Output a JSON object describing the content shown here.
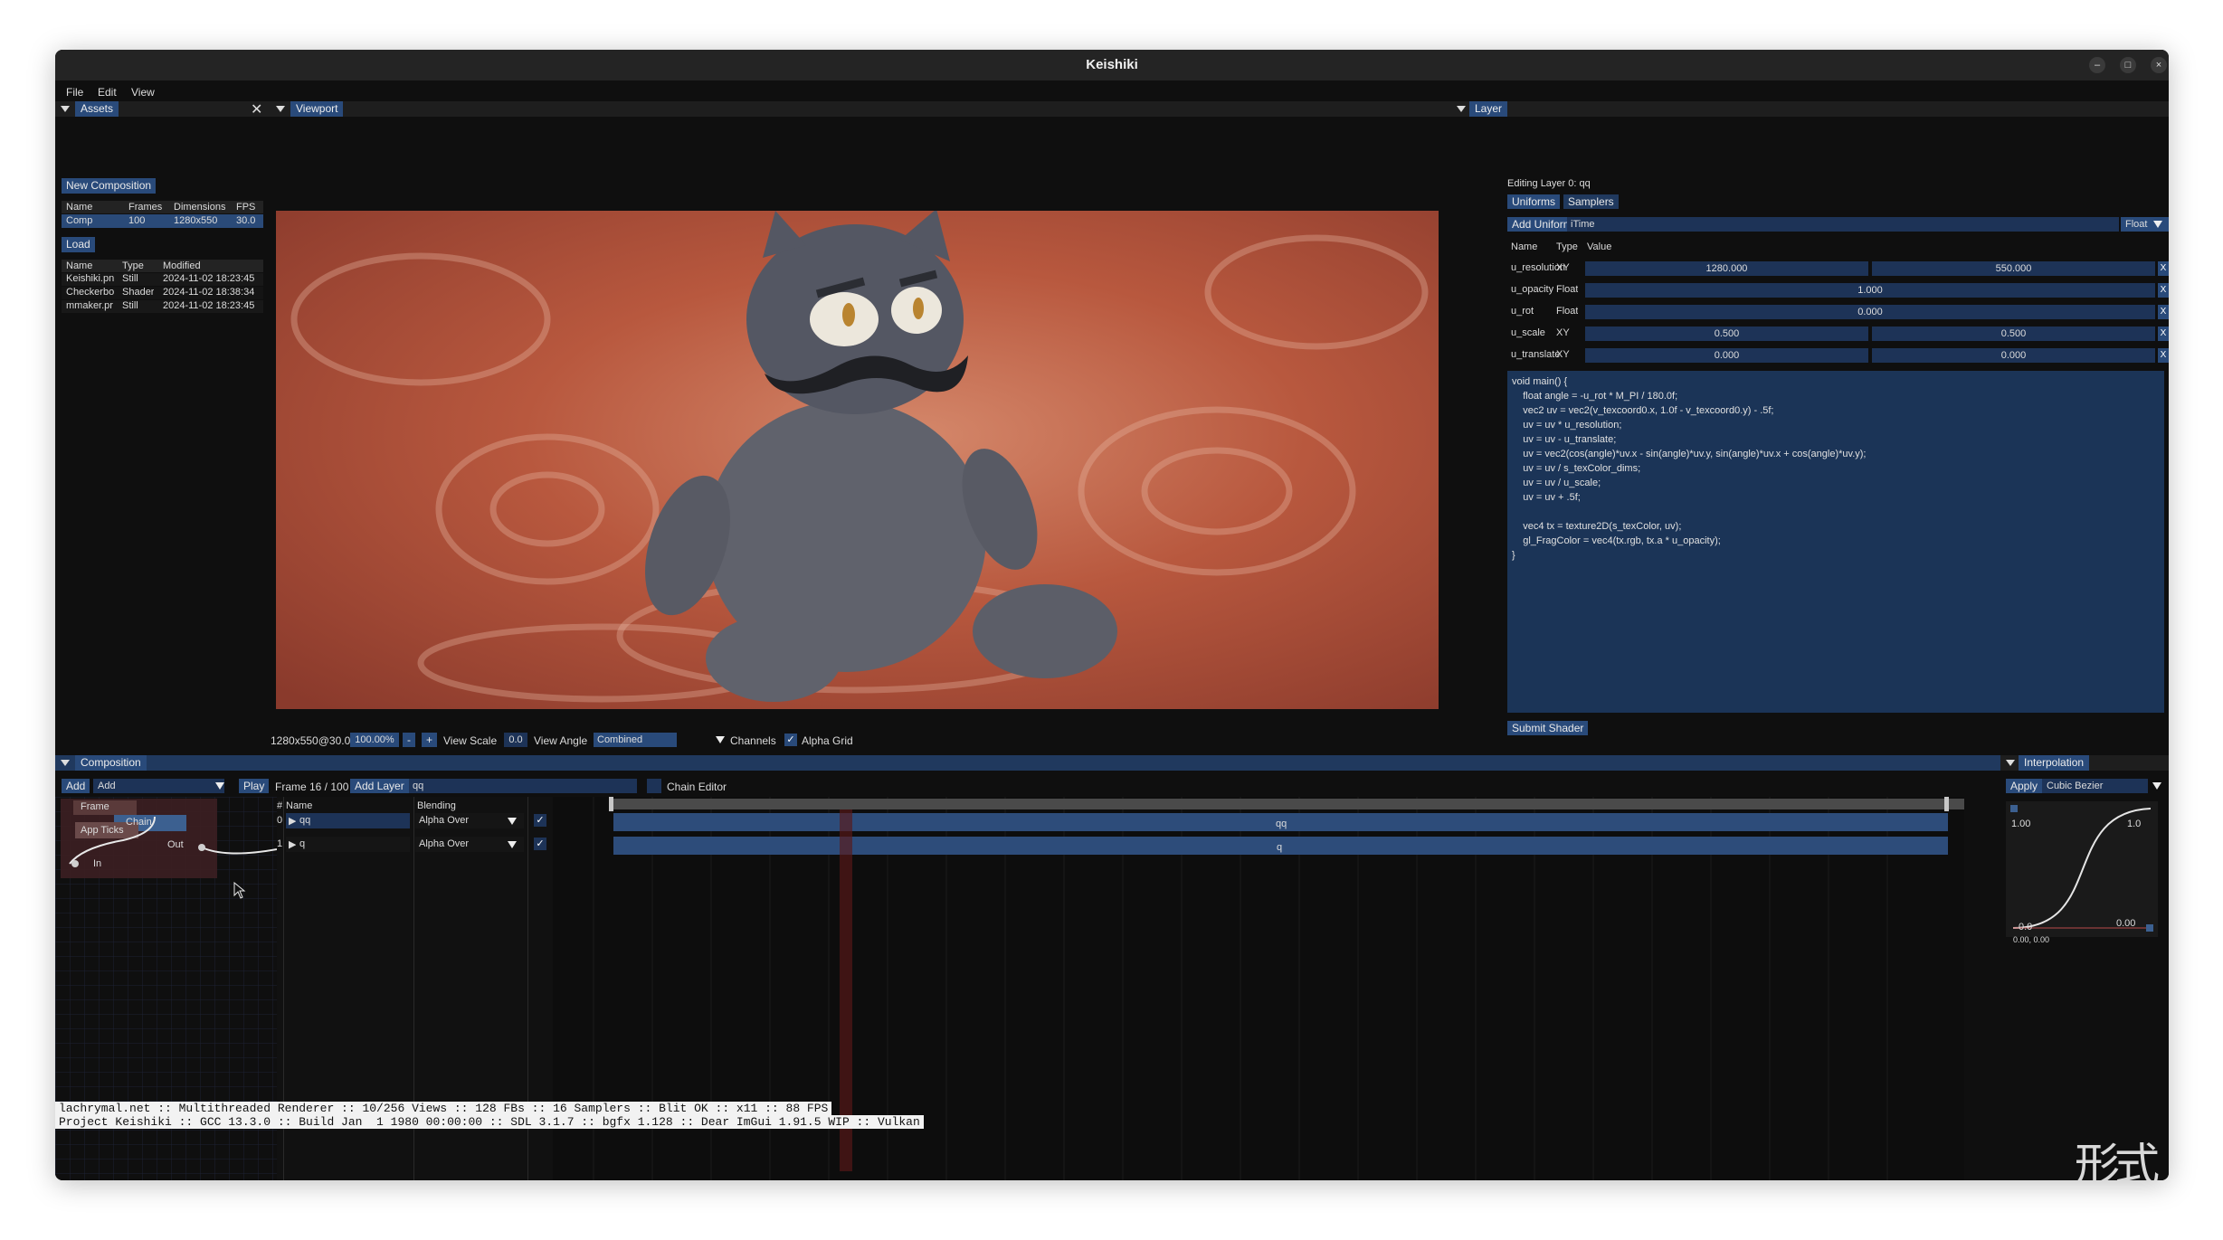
{
  "window": {
    "title": "Keishiki",
    "controls": {
      "minimize": "–",
      "maximize": "□",
      "close": "×"
    }
  },
  "menu": [
    "File",
    "Edit",
    "View"
  ],
  "assets": {
    "tab": "Assets",
    "new_composition": "New Composition",
    "comp_headers": [
      "Name",
      "Frames",
      "Dimensions",
      "FPS"
    ],
    "comp_rows": [
      [
        "Comp",
        "100",
        "1280x550",
        "30.0"
      ]
    ],
    "load": "Load",
    "file_headers": [
      "Name",
      "Type",
      "Modified"
    ],
    "file_rows": [
      [
        "Keishiki.pn",
        "Still",
        "2024-11-02 18:23:45"
      ],
      [
        "Checkerbo",
        "Shader",
        "2024-11-02 18:38:34"
      ],
      [
        "mmaker.pr",
        "Still",
        "2024-11-02 18:23:45"
      ]
    ]
  },
  "viewport": {
    "tab": "Viewport",
    "status": "1280x550@30.0",
    "zoom": "100.00%",
    "minus": "-",
    "plus": "+",
    "view_scale_label": "View Scale",
    "view_scale_value": "0.0",
    "view_angle_label": "View Angle",
    "channels_value": "Combined",
    "channels_label": "Channels",
    "alpha_grid_label": "Alpha Grid"
  },
  "layer": {
    "tab": "Layer",
    "editing": "Editing Layer 0: qq",
    "tabs": [
      "Uniforms",
      "Samplers"
    ],
    "add_uniform": "Add Uniform",
    "new_uniform_name": "iTime",
    "new_uniform_type": "Float",
    "headers": [
      "Name",
      "Type",
      "Value"
    ],
    "uniforms": [
      {
        "name": "u_resolution",
        "type": "XY",
        "v1": "1280.000",
        "v2": "550.000"
      },
      {
        "name": "u_opacity",
        "type": "Float",
        "v1": "1.000"
      },
      {
        "name": "u_rot",
        "type": "Float",
        "v1": "0.000"
      },
      {
        "name": "u_scale",
        "type": "XY",
        "v1": "0.500",
        "v2": "0.500"
      },
      {
        "name": "u_translate",
        "type": "XY",
        "v1": "0.000",
        "v2": "0.000"
      }
    ],
    "remove": "X",
    "shader_code": "void main() {\n    float angle = -u_rot * M_PI / 180.0f;\n    vec2 uv = vec2(v_texcoord0.x, 1.0f - v_texcoord0.y) - .5f;\n    uv = uv * u_resolution;\n    uv = uv - u_translate;\n    uv = vec2(cos(angle)*uv.x - sin(angle)*uv.y, sin(angle)*uv.x + cos(angle)*uv.y);\n    uv = uv / s_texColor_dims;\n    uv = uv / u_scale;\n    uv = uv + .5f;\n\n    vec4 tx = texture2D(s_texColor, uv);\n    gl_FragColor = vec4(tx.rgb, tx.a * u_opacity);\n}",
    "submit": "Submit Shader"
  },
  "composition": {
    "tab": "Composition",
    "add": "Add",
    "add_select": "Add",
    "play": "Play",
    "frame": "Frame 16 / 100",
    "add_layer": "Add Layer",
    "layer_name_input": "qq",
    "chain_editor": "Chain Editor",
    "nodes": {
      "frame": "Frame",
      "chain": "Chain",
      "app_ticks": "App Ticks",
      "out": "Out",
      "in": "In"
    },
    "layer_headers": [
      "#",
      "Name",
      "Blending"
    ],
    "layers": [
      {
        "index": "0",
        "name": "qq",
        "blending": "Alpha Over",
        "bar": "qq"
      },
      {
        "index": "1",
        "name": "q",
        "blending": "Alpha Over",
        "bar": "q"
      }
    ],
    "playhead_frame": 16,
    "total_frames": 100,
    "overlay_lines": [
      "lachrymal.net :: Multithreaded Renderer :: 10/256 Views :: 128 FBs :: 16 Samplers :: Blit OK :: x11 :: 88 FPS",
      "Project Keishiki :: GCC 13.3.0 :: Build Jan  1 1980 00:00:00 :: SDL 3.1.7 :: bgfx 1.128 :: Dear ImGui 1.91.5 WIP :: Vulkan"
    ]
  },
  "interpolation": {
    "tab": "Interpolation",
    "apply": "Apply",
    "mode": "Cubic Bezier",
    "top_left": "1.00",
    "top_right": "1.0",
    "bottom_left": "0.0",
    "bottom_right": "0.00",
    "axis": "0.00, 0.00"
  },
  "logo": "形式"
}
